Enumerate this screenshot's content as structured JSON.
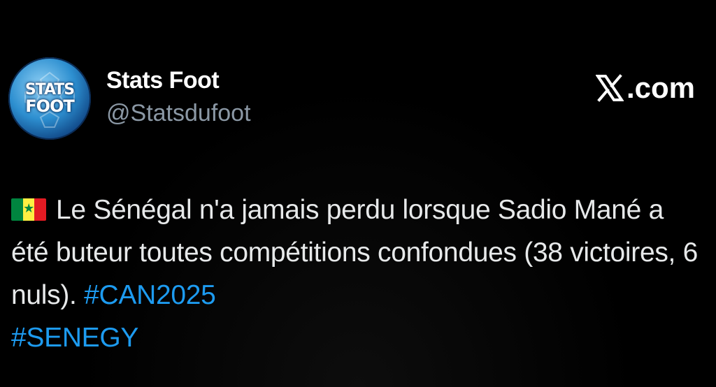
{
  "post": {
    "author": {
      "display_name": "Stats Foot",
      "handle": "@Statsdufoot",
      "avatar_text_line1": "STATS",
      "avatar_text_line2": "FOOT"
    },
    "brand": {
      "icon": "x-logo-icon",
      "label": ".com"
    },
    "flag_icon": "senegal-flag-icon",
    "text": "Le Sénégal n'a jamais perdu lorsque Sadio Mané a été buteur toutes compétitions confondues (38 victoires, 6 nuls).",
    "hashtags": [
      "#CAN2025",
      "#SENEGY"
    ]
  },
  "colors": {
    "background": "#000000",
    "primary_text": "#e7e9ea",
    "secondary_text": "#8b98a5",
    "hashtag": "#1d9bf0",
    "flag_green": "#00853f",
    "flag_yellow": "#fdef42",
    "flag_red": "#e31b23"
  }
}
